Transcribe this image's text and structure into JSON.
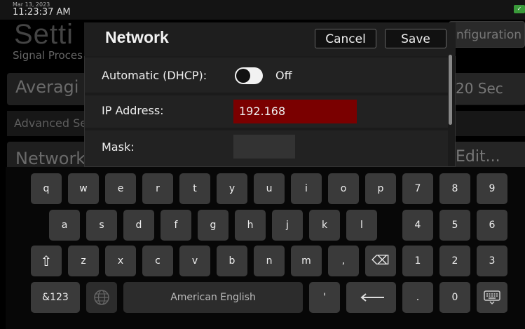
{
  "status": {
    "date": "Mar 13, 2023",
    "time": "11:23:37 AM",
    "battery_color": "#3a9a3a"
  },
  "background": {
    "title": "Setti",
    "section": "Signal Proces",
    "config_button": "nfiguration",
    "averaging_label": "Averagi",
    "averaging_value": "20 Sec",
    "advanced_label": "Advanced Se",
    "network_label": "Network",
    "edit_button": "Edit..."
  },
  "dialog": {
    "title": "Network",
    "cancel_label": "Cancel",
    "save_label": "Save",
    "dhcp_label": "Automatic (DHCP):",
    "dhcp_state": "Off",
    "ip_label": "IP Address:",
    "ip_value": "192.168",
    "mask_label": "Mask:",
    "mask_value": "",
    "ip_field_color": "#7a0000"
  },
  "keyboard": {
    "row1": [
      "q",
      "w",
      "e",
      "r",
      "t",
      "y",
      "u",
      "i",
      "o",
      "p",
      "7",
      "8",
      "9"
    ],
    "row2": [
      "a",
      "s",
      "d",
      "f",
      "g",
      "h",
      "j",
      "k",
      "l",
      "4",
      "5",
      "6"
    ],
    "row3": [
      "⇧",
      "z",
      "x",
      "c",
      "v",
      "b",
      "n",
      "m",
      ",",
      "⌫",
      "1",
      "2",
      "3"
    ],
    "row4": {
      "mode_key": "&123",
      "globe_key": "globe-icon",
      "space_label": "American English",
      "apostrophe": "'",
      "enter_key": "enter-icon",
      "period": ".",
      "zero": "0",
      "hide_key": "keyboard-icon"
    }
  }
}
